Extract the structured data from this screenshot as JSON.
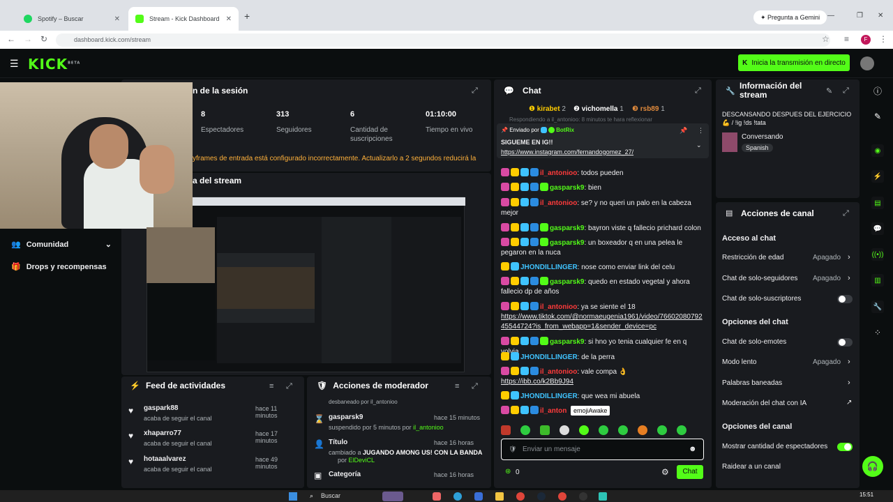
{
  "browser": {
    "tabs": [
      {
        "title": "Spotify – Buscar"
      },
      {
        "title": "Stream - Kick Dashboard"
      }
    ],
    "url": "dashboard.kick.com/stream",
    "gemini": "Pregunta a Gemini",
    "profile": "F"
  },
  "header": {
    "logo": "KICK",
    "beta": "BETA",
    "golive": "Inicia la transmisión en directo"
  },
  "session": {
    "title": "n de la sesión",
    "stats": [
      {
        "value": "8",
        "label": "Espectadores"
      },
      {
        "value": "313",
        "label": "Seguidores"
      },
      {
        "value": "6",
        "label": "Cantidad de suscripciones"
      },
      {
        "value": "01:10:00",
        "label": "Tiempo en vivo"
      }
    ],
    "warning": "yframes de entrada está configurado incorrectamente. Actualizarlo a 2 segundos reducirá la"
  },
  "preview": {
    "title": "a del stream"
  },
  "sidebar": {
    "items": [
      {
        "label": "Comunidad"
      },
      {
        "label": "Drops y recompensas"
      }
    ]
  },
  "feed": {
    "title": "Feed de actividades",
    "items": [
      {
        "user": "gaspark88",
        "time": "hace 11 minutos",
        "desc": "acaba de seguir el canal"
      },
      {
        "user": "xhaparro77",
        "time": "hace 17 minutos",
        "desc": "acaba de seguir el canal"
      },
      {
        "user": "hotaaalvarez",
        "time": "hace 49 minutos",
        "desc": "acaba de seguir el canal"
      }
    ]
  },
  "modactions": {
    "title": "Acciones de moderador",
    "top": "desbaneado por il_antonioo",
    "items": [
      {
        "user": "gasparsk9",
        "time": "hace 15 minutos",
        "desc": "suspendido por 5 minutos por",
        "by": "il_antonioo"
      },
      {
        "label": "Título",
        "time": "hace 16 horas",
        "desc": "cambiado a",
        "value": "JUGANDO AMONG US! CON LA BANDA",
        "by": "ElDeviCL"
      },
      {
        "label": "Categoría",
        "time": "hace 16 horas"
      }
    ]
  },
  "chat": {
    "title": "Chat",
    "top": [
      {
        "name": "kirabet",
        "n": "2"
      },
      {
        "name": "vichomella",
        "n": "1"
      },
      {
        "name": "rsb89",
        "n": "1"
      }
    ],
    "reply": "Respondiendo a il_antonioo: 8 minutos te hara reflexionar",
    "pinned": {
      "by": "Enviado por",
      "bot": "BotRix",
      "text": "SIGUEME EN IG!!",
      "link": "https://www.instagram.com/fernandogomez_27/"
    },
    "messages": [
      {
        "user": "il_antonioo",
        "text": "todos pueden",
        "color": "#ff3b3b"
      },
      {
        "user": "gasparsk9",
        "text": "bien",
        "color": "#53fc18"
      },
      {
        "user": "il_antonioo",
        "text": "se? y no queri un palo en la cabeza mejor",
        "color": "#ff3b3b"
      },
      {
        "user": "gasparsk9",
        "text": "bayron viste q fallecio prichard colon",
        "color": "#53fc18"
      },
      {
        "user": "gasparsk9",
        "text": "un boxeador q en una pelea le pegaron en la nuca",
        "color": "#53fc18"
      },
      {
        "user": "JHONDILLINGER",
        "text": "nose como enviar link del celu",
        "color": "#3fc3ff"
      },
      {
        "user": "gasparsk9",
        "text": "quedo en estado vegetal y ahora fallecio dp de años",
        "color": "#53fc18"
      },
      {
        "user": "il_antonioo",
        "text": "ya se siente el 18",
        "link": "https://www.tiktok.com/@normaeugenia1961/video/7660208079245544724?is_from_webapp=1&sender_device=pc",
        "color": "#ff3b3b"
      },
      {
        "user": "gasparsk9",
        "text": "si hno yo tenia cualquier fe en q volvia",
        "color": "#53fc18"
      },
      {
        "user": "JHONDILLINGER",
        "text": "de la perra",
        "color": "#3fc3ff"
      },
      {
        "user": "il_antonioo",
        "text": "vale compa 👌",
        "link": "https://ibb.co/k2Bb9J94",
        "color": "#ff3b3b"
      },
      {
        "user": "JHONDILLINGER",
        "text": "que wea mi abuela",
        "color": "#3fc3ff"
      },
      {
        "user": "il_anton",
        "text": "",
        "color": "#ff3b3b"
      }
    ],
    "tooltip": "emojiAwake",
    "placeholder": "Enviar un mensaje",
    "count": "0",
    "send": "Chat"
  },
  "info": {
    "title": "Información del stream",
    "stream_title": "DESCANSANDO DESPUES DEL EJERCICIO💪 / !ig !ds !tata",
    "category": "Conversando",
    "lang": "Spanish"
  },
  "channel": {
    "title": "Acciones de canal",
    "sections": [
      {
        "heading": "Acceso al chat",
        "rows": [
          {
            "label": "Restricción de edad",
            "value": "Apagado",
            "kind": "arrow"
          },
          {
            "label": "Chat de solo-seguidores",
            "value": "Apagado",
            "kind": "arrow"
          },
          {
            "label": "Chat de solo-suscriptores",
            "value": "",
            "kind": "toggle-off"
          }
        ]
      },
      {
        "heading": "Opciones del chat",
        "rows": [
          {
            "label": "Chat de solo-emotes",
            "value": "",
            "kind": "toggle-off"
          },
          {
            "label": "Modo lento",
            "value": "Apagado",
            "kind": "arrow"
          },
          {
            "label": "Palabras baneadas",
            "value": "",
            "kind": "arrow"
          },
          {
            "label": "Moderación del chat con IA",
            "value": "",
            "kind": "link"
          }
        ]
      },
      {
        "heading": "Opciones del canal",
        "rows": [
          {
            "label": "Mostrar cantidad de espectadores",
            "value": "",
            "kind": "toggle-on"
          },
          {
            "label": "Raidear a un canal",
            "value": "",
            "kind": "none"
          }
        ]
      }
    ]
  },
  "taskbar": {
    "search": "Buscar",
    "time": "15:51"
  }
}
